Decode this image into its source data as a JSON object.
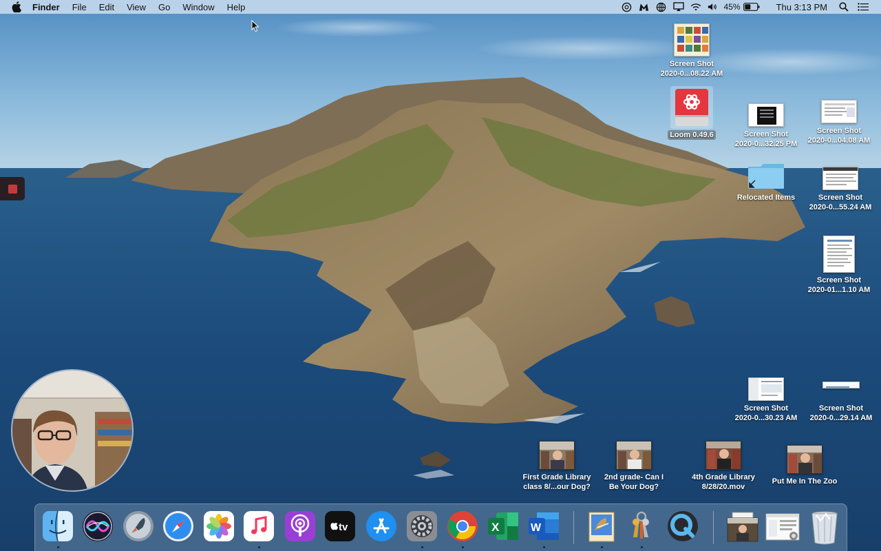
{
  "menubar": {
    "app_name": "Finder",
    "menus": [
      "File",
      "Edit",
      "View",
      "Go",
      "Window",
      "Help"
    ],
    "battery_percent": "45%",
    "clock": "Thu 3:13 PM",
    "status_icons": [
      "creative-cloud-icon",
      "malwarebytes-icon",
      "globe-icon",
      "airplay-icon",
      "wifi-icon",
      "volume-icon",
      "battery-icon",
      "search-icon",
      "notification-center-icon"
    ]
  },
  "desktop": {
    "icons": [
      {
        "line1": "Screen Shot",
        "line2": "2020-0...08.22 AM"
      },
      {
        "line1": "Loom 0.49.6",
        "line2": ""
      },
      {
        "line1": "Screen Shot",
        "line2": "2020-0...32.25 PM"
      },
      {
        "line1": "Screen Shot",
        "line2": "2020-0...04.08 AM"
      },
      {
        "line1": "Relocated Items",
        "line2": ""
      },
      {
        "line1": "Screen Shot",
        "line2": "2020-0...55.24 AM"
      },
      {
        "line1": "Screen Shot",
        "line2": "2020-01...1.10 AM"
      },
      {
        "line1": "Screen Shot",
        "line2": "2020-0...30.23 AM"
      },
      {
        "line1": "Screen Shot",
        "line2": "2020-0...29.14 AM"
      },
      {
        "line1": "First Grade Library",
        "line2": "class 8/...our Dog?"
      },
      {
        "line1": "2nd  grade-  Can I",
        "line2": "Be Your Dog?"
      },
      {
        "line1": "4th Grade Library",
        "line2": "8/28/20.mov"
      },
      {
        "line1": "Put Me In The Zoo",
        "line2": ""
      }
    ]
  },
  "dock": {
    "items": [
      "finder-icon",
      "siri-icon",
      "launchpad-icon",
      "safari-icon",
      "photos-icon",
      "music-icon",
      "podcasts-icon",
      "apple-tv-icon",
      "app-store-icon",
      "system-preferences-icon",
      "chrome-icon",
      "excel-icon",
      "word-icon",
      "mail-icon",
      "keychain-icon",
      "quicktime-icon",
      "downloads-stack-icon",
      "preview-stack-icon",
      "trash-icon"
    ],
    "tv_label": "tv",
    "excel_letter": "X",
    "word_letter": "W"
  },
  "colors": {
    "sea": "#1c4e80",
    "sky": "#7fb0d6",
    "rock": "#9a8060",
    "vegetation": "#6a7a3a",
    "loom_red": "#e5353f",
    "folder_blue": "#7cc6ef"
  }
}
